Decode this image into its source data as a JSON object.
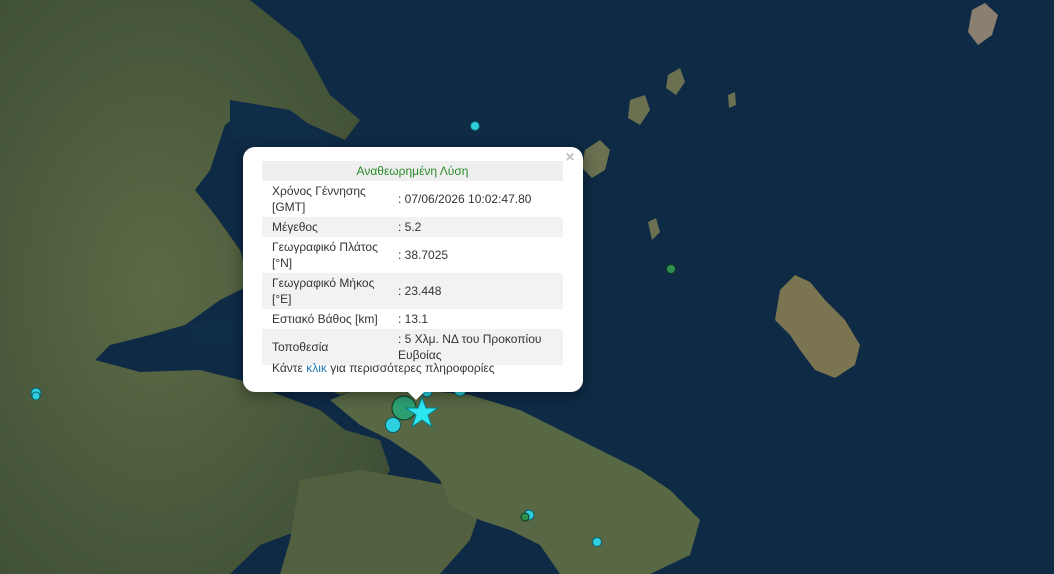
{
  "popup": {
    "title": "Αναθεωρημένη Λύση",
    "close_label": "×",
    "rows": [
      {
        "label": "Χρόνος Γέννησης [GMT]",
        "value": ": 07/06/2026 10:02:47.80"
      },
      {
        "label": "Μέγεθος",
        "value": ": 5.2"
      },
      {
        "label": "Γεωγραφικό Πλάτος [°N]",
        "value": ": 38.7025"
      },
      {
        "label": "Γεωγραφικό Μήκος [°E]",
        "value": ": 23.448"
      },
      {
        "label": "Εστιακό Βάθος [km]",
        "value": ": 13.1"
      },
      {
        "label": "Τοποθεσία",
        "value": ": 5 Χλμ. ΝΔ του Προκοπίου Ευβοίας"
      }
    ],
    "more_prefix": "Κάντε",
    "more_link": "κλικ",
    "more_suffix": "για περισσότερες πληροφορίες"
  },
  "map": {
    "sea_color": "#0e2a45",
    "land_color": "#4a5a3a",
    "marker_color": "#2ed0e0",
    "star_color": "#2ee6f0",
    "quake_markers": [
      {
        "name": "quake-marker",
        "color": "#2ed0e0"
      },
      {
        "name": "quake-marker",
        "color": "#2e8f4f"
      }
    ],
    "star_icon": "star-icon"
  }
}
